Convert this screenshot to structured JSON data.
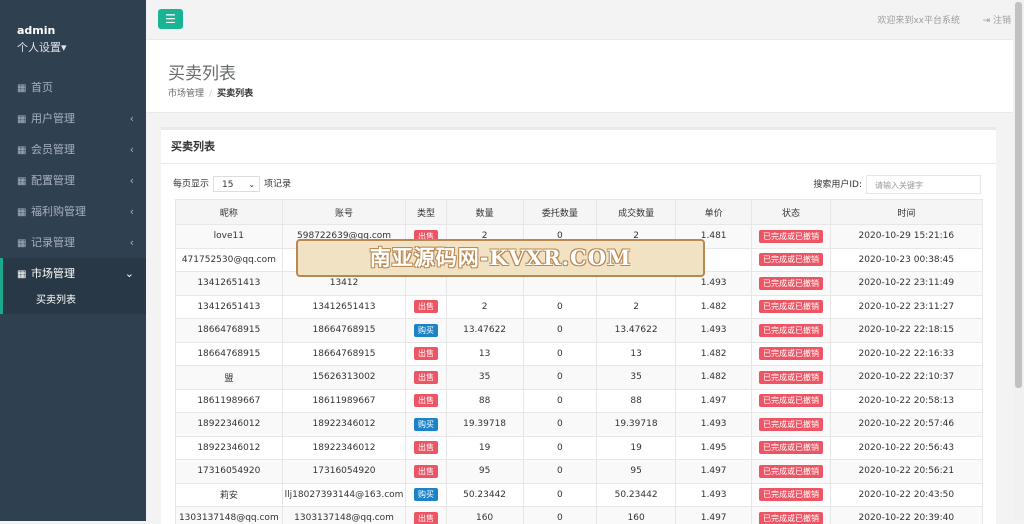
{
  "user": {
    "name": "admin",
    "settings_label": "个人设置▾"
  },
  "sidebar": {
    "items": [
      {
        "label": "首页",
        "chevron": ""
      },
      {
        "label": "用户管理",
        "chevron": "‹"
      },
      {
        "label": "会员管理",
        "chevron": "‹"
      },
      {
        "label": "配置管理",
        "chevron": "‹"
      },
      {
        "label": "福利购管理",
        "chevron": "‹"
      },
      {
        "label": "记录管理",
        "chevron": "‹"
      },
      {
        "label": "市场管理",
        "chevron": "⌄"
      }
    ],
    "sub_item": "买卖列表"
  },
  "topbar": {
    "menu_icon": "☰",
    "welcome": "欢迎来到xx平台系统",
    "logout": "注销",
    "logout_icon": "⇥"
  },
  "heading": {
    "title": "买卖列表",
    "crumb_parent": "市场管理",
    "crumb_sep": "/",
    "crumb_current": "买卖列表"
  },
  "panel": {
    "title": "买卖列表",
    "length_prefix": "每页显示",
    "length_value": "15",
    "length_suffix": "项记录",
    "search_label": "搜索用户ID:",
    "search_placeholder": "请输入关键字"
  },
  "table": {
    "headers": [
      "昵称",
      "账号",
      "类型",
      "数量",
      "委托数量",
      "成交数量",
      "单价",
      "状态",
      "时间"
    ],
    "rows": [
      [
        "love11",
        "598722639@qq.com",
        "出售",
        "2",
        "0",
        "2",
        "1.481",
        "已完成或已撤销",
        "2020-10-29 15:21:16"
      ],
      [
        "471752530@qq.com",
        "",
        "",
        "",
        "",
        "",
        "",
        "已完成或已撤销",
        "2020-10-23 00:38:45"
      ],
      [
        "13412651413",
        "13412",
        "",
        "",
        "",
        "",
        "1.493",
        "已完成或已撤销",
        "2020-10-22 23:11:49"
      ],
      [
        "13412651413",
        "13412651413",
        "出售",
        "2",
        "0",
        "2",
        "1.482",
        "已完成或已撤销",
        "2020-10-22 23:11:27"
      ],
      [
        "18664768915",
        "18664768915",
        "购买",
        "13.47622",
        "0",
        "13.47622",
        "1.493",
        "已完成或已撤销",
        "2020-10-22 22:18:15"
      ],
      [
        "18664768915",
        "18664768915",
        "出售",
        "13",
        "0",
        "13",
        "1.482",
        "已完成或已撤销",
        "2020-10-22 22:16:33"
      ],
      [
        "盟",
        "15626313002",
        "出售",
        "35",
        "0",
        "35",
        "1.482",
        "已完成或已撤销",
        "2020-10-22 22:10:37"
      ],
      [
        "18611989667",
        "18611989667",
        "出售",
        "88",
        "0",
        "88",
        "1.497",
        "已完成或已撤销",
        "2020-10-22 20:58:13"
      ],
      [
        "18922346012",
        "18922346012",
        "购买",
        "19.39718",
        "0",
        "19.39718",
        "1.493",
        "已完成或已撤销",
        "2020-10-22 20:57:46"
      ],
      [
        "18922346012",
        "18922346012",
        "出售",
        "19",
        "0",
        "19",
        "1.495",
        "已完成或已撤销",
        "2020-10-22 20:56:43"
      ],
      [
        "17316054920",
        "17316054920",
        "出售",
        "95",
        "0",
        "95",
        "1.497",
        "已完成或已撤销",
        "2020-10-22 20:56:21"
      ],
      [
        "莉安",
        "llj18027393144@163.com",
        "购买",
        "50.23442",
        "0",
        "50.23442",
        "1.493",
        "已完成或已撤销",
        "2020-10-22 20:43:50"
      ],
      [
        "1303137148@qq.com",
        "1303137148@qq.com",
        "出售",
        "160",
        "0",
        "160",
        "1.497",
        "已完成或已撤销",
        "2020-10-22 20:39:40"
      ]
    ]
  },
  "watermark": "南亚源码网-KVXR.COM",
  "colors": {
    "sidebar": "#2f4050",
    "accent": "#1ab394",
    "sell": "#ed5565",
    "buy": "#1c84c6"
  }
}
